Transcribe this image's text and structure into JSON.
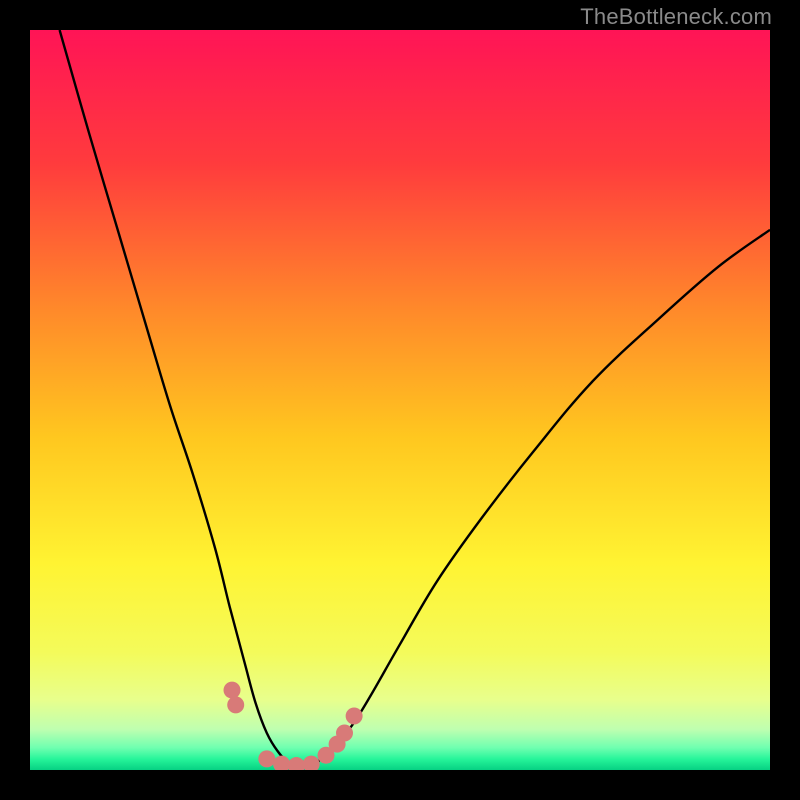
{
  "watermark": "TheBottleneck.com",
  "chart_data": {
    "type": "line",
    "title": "",
    "xlabel": "",
    "ylabel": "",
    "xlim": [
      0,
      100
    ],
    "ylim": [
      0,
      100
    ],
    "series": [
      {
        "name": "curve-left",
        "x": [
          4,
          8,
          12,
          16,
          19,
          22,
          25,
          27,
          29,
          30.5,
          32,
          33.5,
          35,
          37
        ],
        "values": [
          100,
          86,
          72.5,
          59,
          49,
          40,
          30,
          22,
          14.5,
          9,
          5,
          2.5,
          1,
          0.3
        ]
      },
      {
        "name": "curve-right",
        "x": [
          37,
          39,
          41,
          43.5,
          46,
          50,
          55,
          61,
          68,
          76,
          85,
          93,
          100
        ],
        "values": [
          0.3,
          1.2,
          3,
          6,
          10,
          17,
          25.5,
          34,
          43,
          52.5,
          61,
          68,
          73
        ]
      },
      {
        "name": "markers",
        "x": [
          27.3,
          27.8,
          32,
          34,
          36,
          38,
          40,
          41.5,
          42.5,
          43.8
        ],
        "values": [
          10.8,
          8.8,
          1.5,
          0.8,
          0.6,
          0.8,
          2,
          3.5,
          5,
          7.3
        ]
      }
    ],
    "gradient_stops": [
      {
        "offset": 0.0,
        "color": "#ff1456"
      },
      {
        "offset": 0.18,
        "color": "#ff3b3d"
      },
      {
        "offset": 0.38,
        "color": "#ff8a2a"
      },
      {
        "offset": 0.55,
        "color": "#ffc71f"
      },
      {
        "offset": 0.72,
        "color": "#fff332"
      },
      {
        "offset": 0.84,
        "color": "#f4fb5a"
      },
      {
        "offset": 0.905,
        "color": "#e8ff8c"
      },
      {
        "offset": 0.945,
        "color": "#bfffb0"
      },
      {
        "offset": 0.97,
        "color": "#6fffb0"
      },
      {
        "offset": 0.985,
        "color": "#27f59a"
      },
      {
        "offset": 1.0,
        "color": "#06d183"
      }
    ],
    "marker_color": "#d87a78",
    "curve_color": "#000000"
  }
}
